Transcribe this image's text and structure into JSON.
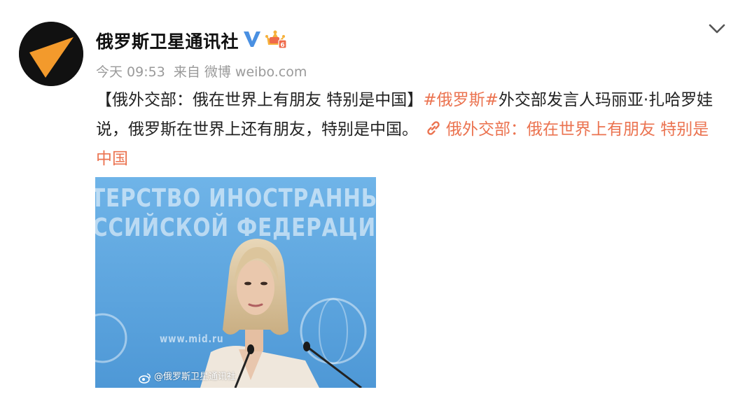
{
  "account": {
    "name": "俄罗斯卫星通讯社",
    "avatar_icon": "orange-triangle-logo",
    "verified_icon": "verified-v-icon",
    "badge_icon": "vip-crown-badge-icon"
  },
  "meta": {
    "time": "今天 09:53",
    "source_prefix": "来自",
    "source": "微博 weibo.com"
  },
  "post": {
    "title": "【俄外交部：俄在世界上有朋友 特别是中国】",
    "hashtag": "#俄罗斯#",
    "body": "外交部发言人玛丽亚·扎哈罗娃说，俄罗斯在世界上还有朋友，特别是中国。",
    "link_text": "俄外交部：俄在世界上有朋友 特别是中国"
  },
  "image": {
    "wall_line_1": "ТЕРСТВО ИНОСТРАННЫХ ДЕЛ",
    "wall_line_2": "ССИЙСКОЙ ФЕДЕРАЦИИ",
    "wall_url": "www.mid.ru",
    "watermark": "@俄罗斯卫星通讯社"
  },
  "colors": {
    "link": "#eb7350",
    "meta": "#9a9a9a",
    "verified": "#4a90e2",
    "avatar_accent": "#f39a2c",
    "photo_bg": "#5aa6e0"
  }
}
